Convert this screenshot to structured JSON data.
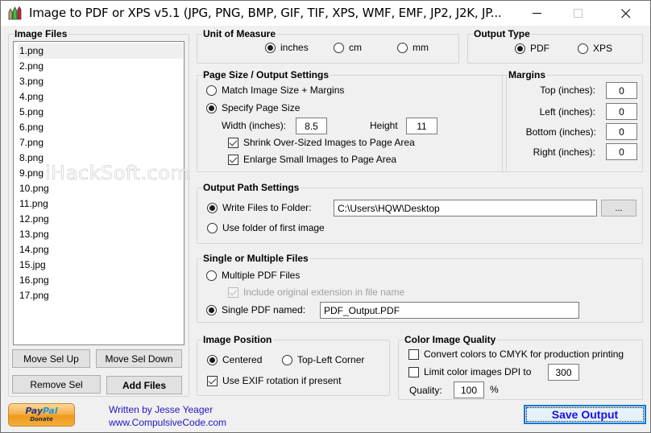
{
  "window": {
    "title": "Image to PDF or XPS  v5.1   (JPG, PNG, BMP, GIF, TIF, XPS, WMF, EMF, JP2, J2K, JP...",
    "icon": "app-crayons-icon",
    "controls": {
      "minimize": "minimize-icon",
      "maximize": "maximize-icon",
      "close": "close-icon"
    }
  },
  "image_files": {
    "title": "Image Files",
    "items": [
      "1.png",
      "2.png",
      "3.png",
      "4.png",
      "5.png",
      "6.png",
      "7.png",
      "8.png",
      "9.png",
      "10.png",
      "11.png",
      "12.png",
      "13.png",
      "14.png",
      "15.jpg",
      "16.png",
      "17.png"
    ],
    "selected_index": 0,
    "buttons": {
      "move_up": "Move Sel Up",
      "move_down": "Move Sel Down",
      "remove": "Remove Sel",
      "add": "Add Files"
    }
  },
  "watermark": "iHackSoft.com",
  "unit_of_measure": {
    "title": "Unit of Measure",
    "options": [
      "inches",
      "cm",
      "mm"
    ],
    "selected": "inches"
  },
  "output_type": {
    "title": "Output Type",
    "options": [
      "PDF",
      "XPS"
    ],
    "selected": "PDF"
  },
  "page_size": {
    "title": "Page Size / Output Settings",
    "match_label": "Match Image Size + Margins",
    "specify_label": "Specify Page Size",
    "selected": "specify",
    "width_label": "Width (inches):",
    "width_value": "8.5",
    "height_label": "Height",
    "height_value": "11",
    "shrink_label": "Shrink Over-Sized Images to Page Area",
    "shrink_checked": true,
    "enlarge_label": "Enlarge Small Images to Page Area",
    "enlarge_checked": true
  },
  "margins": {
    "title": "Margins",
    "top_label": "Top (inches):",
    "top_value": "0",
    "left_label": "Left (inches):",
    "left_value": "0",
    "bottom_label": "Bottom (inches):",
    "bottom_value": "0",
    "right_label": "Right (inches):",
    "right_value": "0"
  },
  "output_path": {
    "title": "Output Path Settings",
    "write_label": "Write Files to Folder:",
    "folder_value": "C:\\Users\\HQW\\Desktop",
    "browse_label": "...",
    "first_image_label": "Use folder of first image",
    "selected": "write"
  },
  "single_multiple": {
    "title": "Single or Multiple Files",
    "multiple_label": "Multiple PDF Files",
    "include_ext_label": "Include original extension in file name",
    "include_ext_checked": true,
    "include_ext_disabled": true,
    "single_label": "Single PDF named:",
    "single_value": "PDF_Output.PDF",
    "selected": "single"
  },
  "image_position": {
    "title": "Image Position",
    "centered_label": "Centered",
    "topleft_label": "Top-Left Corner",
    "selected": "centered",
    "exif_label": "Use EXIF rotation if present",
    "exif_checked": true
  },
  "color_quality": {
    "title": "Color Image Quality",
    "cmyk_label": "Convert colors to CMYK for production printing",
    "cmyk_checked": false,
    "limit_dpi_label": "Limit color images DPI to",
    "limit_dpi_checked": false,
    "dpi_value": "300",
    "quality_label": "Quality:",
    "quality_value": "100",
    "quality_unit": "%"
  },
  "footer": {
    "paypal_brand_1": "Pay",
    "paypal_brand_2": "Pal",
    "paypal_donate": "Donate",
    "credit_line_1": "Written by Jesse Yeager",
    "credit_line_2": "www.CompulsiveCode.com",
    "save_label": "Save Output"
  },
  "colors": {
    "link": "#2016c4",
    "save_text": "#1a10e6",
    "focus_border": "#0078d7"
  }
}
